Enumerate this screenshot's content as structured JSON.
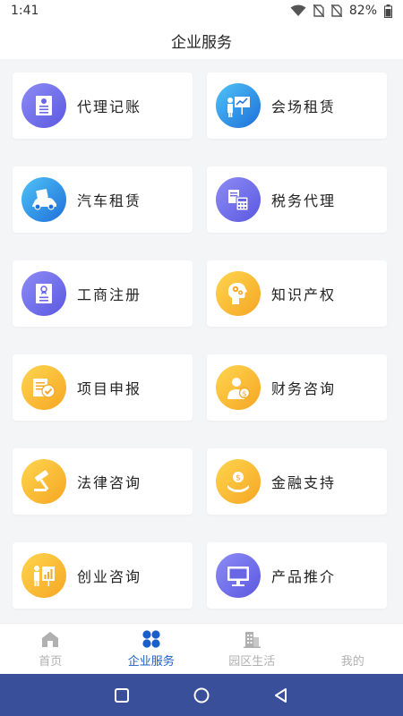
{
  "status": {
    "time": "1:41",
    "battery": "82%"
  },
  "header": {
    "title": "企业服务"
  },
  "services": [
    {
      "label": "代理记账",
      "icon": "ledger-icon",
      "color": "purple"
    },
    {
      "label": "会场租赁",
      "icon": "presentation-icon",
      "color": "blue"
    },
    {
      "label": "汽车租赁",
      "icon": "car-icon",
      "color": "blue"
    },
    {
      "label": "税务代理",
      "icon": "tax-calculator-icon",
      "color": "purple"
    },
    {
      "label": "工商注册",
      "icon": "certificate-icon",
      "color": "purple"
    },
    {
      "label": "知识产权",
      "icon": "brain-gears-icon",
      "color": "orange"
    },
    {
      "label": "项目申报",
      "icon": "document-check-icon",
      "color": "orange"
    },
    {
      "label": "财务咨询",
      "icon": "finance-advisor-icon",
      "color": "orange"
    },
    {
      "label": "法律咨询",
      "icon": "gavel-icon",
      "color": "orange"
    },
    {
      "label": "金融支持",
      "icon": "money-hand-icon",
      "color": "orange"
    },
    {
      "label": "创业咨询",
      "icon": "startup-chart-icon",
      "color": "orange"
    },
    {
      "label": "产品推介",
      "icon": "monitor-icon",
      "color": "purple"
    }
  ],
  "bottom_nav": [
    {
      "label": "首页",
      "icon": "home-icon",
      "active": false
    },
    {
      "label": "企业服务",
      "icon": "grid-petals-icon",
      "active": true
    },
    {
      "label": "园区生活",
      "icon": "buildings-icon",
      "active": false
    },
    {
      "label": "我的",
      "icon": "user-icon",
      "active": false
    }
  ],
  "colors": {
    "active": "#1a5fc9",
    "inactive": "#b0b0b0",
    "system_nav": "#3a4f9a"
  }
}
